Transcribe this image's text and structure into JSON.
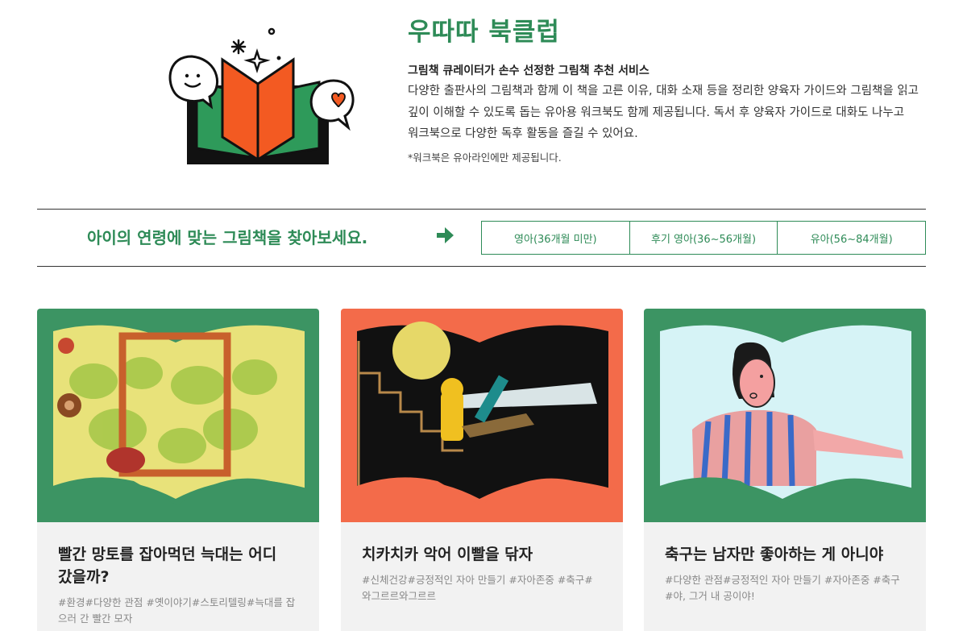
{
  "intro": {
    "title": "우따따 북클럽",
    "subtitle": "그림책 큐레이터가 손수 선정한 그림책 추천 서비스",
    "description": "다양한 출판사의 그림책과 함께 이 책을 고른 이유, 대화 소재 등을 정리한 양육자 가이드와 그림책을 읽고 깊이 이해할 수 있도록 돕는 유아용 워크북도 함께 제공됩니다. 독서 후 양육자 가이드로 대화도 나누고 워크북으로 다양한 독후 활동을 즐길 수 있어요.",
    "note": "*워크북은 유아라인에만 제공됩니다."
  },
  "age_filter": {
    "prompt": "아이의 연령에 맞는 그림책을 찾아보세요.",
    "tabs": [
      {
        "label": "영아(36개월 미만)"
      },
      {
        "label": "후기 영아(36~56개월)"
      },
      {
        "label": "유아(56~84개월)"
      }
    ]
  },
  "books": [
    {
      "title": "빨간 망토를 잡아먹던 늑대는 어디 갔을까?",
      "tags": "#환경#다양한 관점 #옛이야기#스토리텔링#늑대를 잡으러 간 빨간 모자",
      "cover_color": "#3c9463"
    },
    {
      "title": "치카치카 악어 이빨을 닦자",
      "tags": "#신체건강#긍정적인 자아 만들기 #자아존중 #축구#와그르르와그르르",
      "cover_color": "#f36b4a"
    },
    {
      "title": "축구는 남자만 좋아하는 게 아니야",
      "tags": "#다양한 관점#긍정적인 자아 만들기 #자아존중 #축구#야, 그거 내 공이야!",
      "cover_color": "#3c9463"
    }
  ],
  "colors": {
    "brand_green": "#2e8b57",
    "accent_orange": "#f36b4a",
    "card_bg": "#f2f2f2"
  }
}
